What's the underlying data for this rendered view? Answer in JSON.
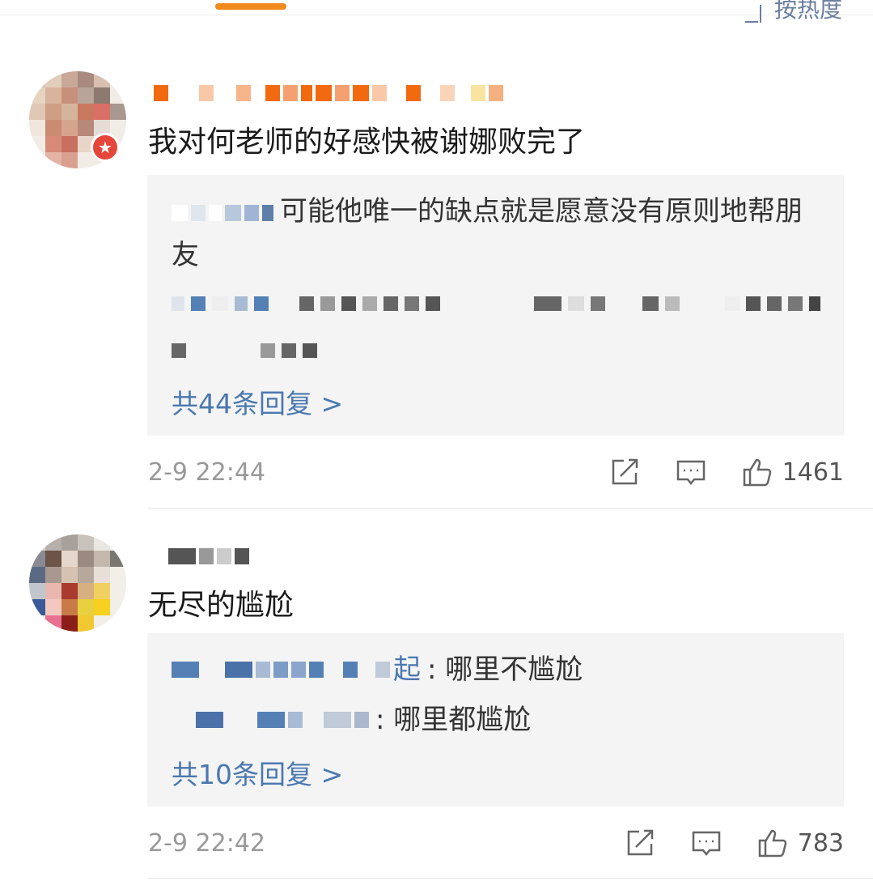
{
  "header": {
    "sort_label": "按热度"
  },
  "comments": [
    {
      "text": "我对何老师的好感快被谢娜败完了",
      "badge_icon": "vip-badge-icon",
      "reply_preview": {
        "first_reply_text": "可能他唯一的缺点就是愿意没有原则地帮朋友"
      },
      "more_replies_label": "共44条回复 >",
      "timestamp": "2-9 22:44",
      "like_count": "1461"
    },
    {
      "text": "无尽的尴尬",
      "reply_preview": {
        "reply1_name_tail": "起",
        "reply1_text": ": 哪里不尴尬",
        "reply2_text": ": 哪里都尴尬"
      },
      "more_replies_label": "共10条回复 >",
      "timestamp": "2-9 22:42",
      "like_count": "783"
    }
  ],
  "colors": {
    "accent": "#f28a1d",
    "link": "#4a78b0",
    "reply_bg": "#f4f4f4",
    "meta_text": "#999999"
  }
}
